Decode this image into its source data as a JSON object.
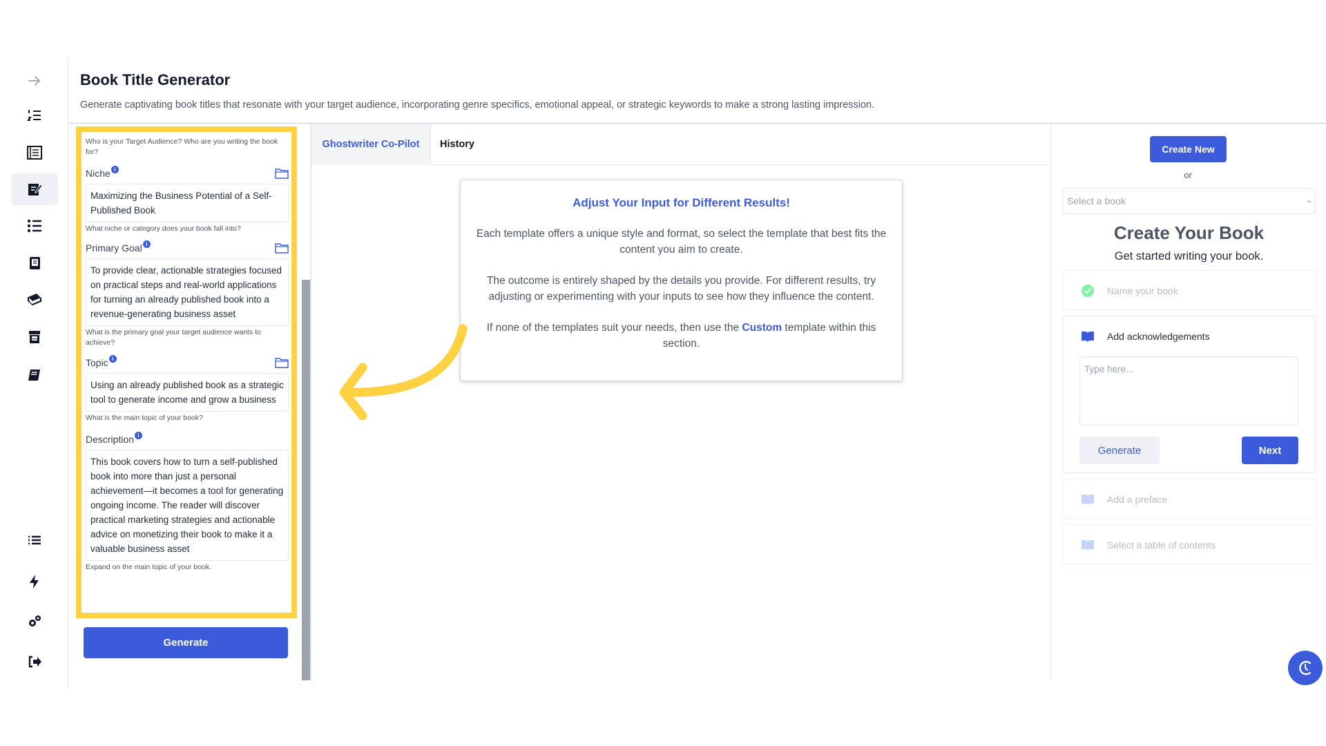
{
  "header": {
    "title": "Book Title Generator",
    "description": "Generate captivating book titles that resonate with your target audience, incorporating genre specifics, emotional appeal, or strategic keywords to make a strong lasting impression."
  },
  "sidebar": {
    "items": [
      {
        "icon": "arrow-right-icon",
        "active": false
      },
      {
        "icon": "numbered-list-icon",
        "active": false
      },
      {
        "icon": "book-pages-icon",
        "active": false
      },
      {
        "icon": "edit-document-icon",
        "active": true
      },
      {
        "icon": "bullet-list-icon",
        "active": false
      },
      {
        "icon": "tablet-book-icon",
        "active": false
      },
      {
        "icon": "books-stack-icon",
        "active": false
      },
      {
        "icon": "archive-icon",
        "active": false
      },
      {
        "icon": "book-icon",
        "active": false
      },
      {
        "icon": "menu-list-icon",
        "active": false
      },
      {
        "icon": "bolt-icon",
        "active": false
      },
      {
        "icon": "settings-icon",
        "active": false
      },
      {
        "icon": "logout-icon",
        "active": false
      }
    ]
  },
  "form": {
    "target_audience_hint": "Who is your Target Audience? Who are you writing the book for?",
    "fields": {
      "niche": {
        "label": "Niche",
        "value": "Maximizing the Business Potential of a Self-Published Book",
        "hint": "What niche or category does your book fall into?"
      },
      "primary_goal": {
        "label": "Primary Goal",
        "value": "To provide clear, actionable strategies focused on practical steps and real-world applications for turning an already published book into a revenue-generating business asset",
        "hint": "What is the primary goal your target audience wants to achieve?"
      },
      "topic": {
        "label": "Topic",
        "value": "Using an already published book as a strategic tool to generate income and grow a business",
        "hint": "What is the main topic of your book?"
      },
      "description": {
        "label": "Description",
        "value": "This book covers how to turn a self-published book into more than just a personal achievement—it becomes a tool for generating ongoing income. The reader will discover practical marketing strategies and actionable advice on monetizing their book to make it a valuable business asset",
        "hint": "Expand on the main topic of your book."
      }
    },
    "generate_label": "Generate"
  },
  "tabs": [
    {
      "label": "Ghostwriter Co-Pilot",
      "active": true
    },
    {
      "label": "History",
      "active": false
    }
  ],
  "info_card": {
    "title": "Adjust Your Input for Different Results!",
    "p1": "Each template offers a unique style and format, so select the template that best fits the content you aim to create.",
    "p2": "The outcome is entirely shaped by the details you provide. For different results, try adjusting or experimenting with your inputs to see how they influence the content.",
    "p3_before": "If none of the templates suit your needs, then use the ",
    "p3_link": "Custom",
    "p3_after": " template within this section."
  },
  "right_panel": {
    "create_new_label": "Create New",
    "or_label": "or",
    "select_book_placeholder": "Select a book",
    "title": "Create Your Book",
    "subtitle": "Get started writing your book.",
    "steps": {
      "name": "Name your book",
      "acknowledgements": "Add acknowledgements",
      "preface": "Add a preface",
      "toc": "Select a table of contents"
    },
    "ack_placeholder": "Type here...",
    "generate_label": "Generate",
    "next_label": "Next"
  },
  "colors": {
    "accent": "#3b5bdb",
    "highlight": "#fdd142",
    "success": "#86efac"
  }
}
